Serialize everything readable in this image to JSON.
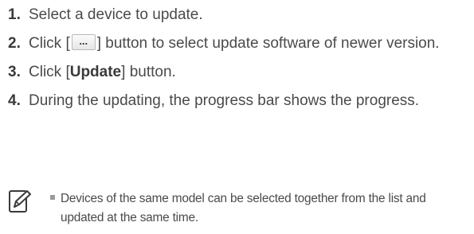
{
  "steps": [
    {
      "number": "1.",
      "text": "Select a device to update."
    },
    {
      "number": "2.",
      "text_before": "Click [",
      "button_label": "...",
      "text_after": "] button to select update software of newer version."
    },
    {
      "number": "3.",
      "text_before": "Click [",
      "bold": "Update",
      "text_after": "] button."
    },
    {
      "number": "4.",
      "text": "During the updating, the progress bar shows the progress."
    }
  ],
  "note": {
    "icon": "note-pencil-icon",
    "text": "Devices of the same model can be selected together from the list and updated at the same time."
  }
}
